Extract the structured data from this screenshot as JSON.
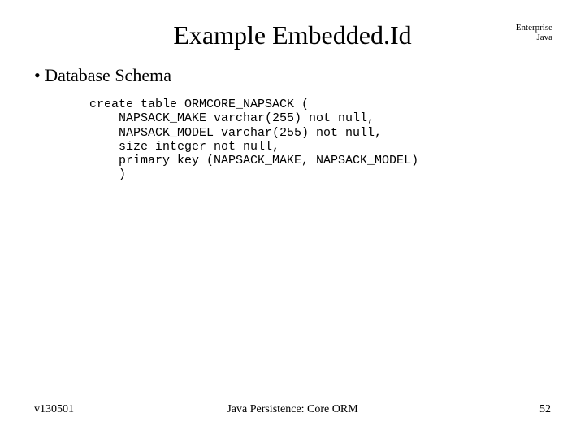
{
  "header": {
    "title": "Example Embedded.Id",
    "corner_line1": "Enterprise",
    "corner_line2": "Java"
  },
  "content": {
    "bullet1": "Database Schema",
    "code": "create table ORMCORE_NAPSACK (\n    NAPSACK_MAKE varchar(255) not null,\n    NAPSACK_MODEL varchar(255) not null,\n    size integer not null,\n    primary key (NAPSACK_MAKE, NAPSACK_MODEL)\n    )"
  },
  "footer": {
    "left": "v130501",
    "center": "Java Persistence: Core ORM",
    "right": "52"
  }
}
